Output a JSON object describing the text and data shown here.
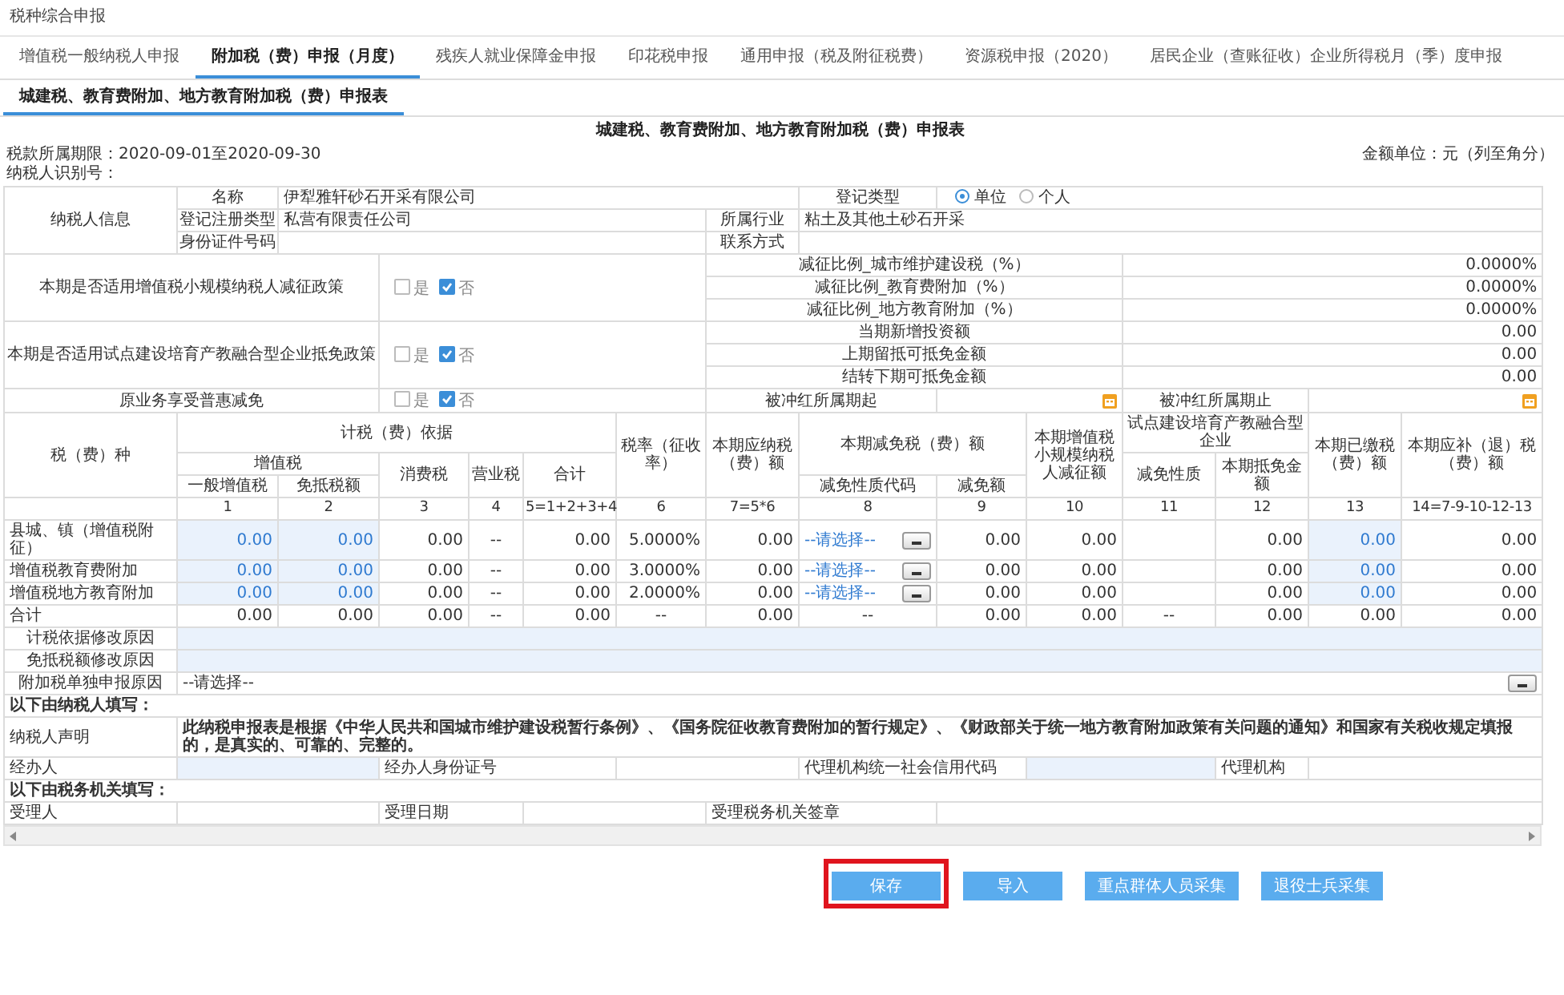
{
  "window": {
    "title": "税种综合申报"
  },
  "tabs": [
    {
      "label": "增值税一般纳税人申报",
      "selected": false
    },
    {
      "label": "附加税（费）申报（月度）",
      "selected": true
    },
    {
      "label": "残疾人就业保障金申报",
      "selected": false
    },
    {
      "label": "印花税申报",
      "selected": false
    },
    {
      "label": "通用申报（税及附征税费）",
      "selected": false
    },
    {
      "label": "资源税申报（2020）",
      "selected": false
    },
    {
      "label": "居民企业（查账征收）企业所得税月（季）度申报",
      "selected": false
    }
  ],
  "sub_tabs": [
    {
      "label": "城建税、教育费附加、地方教育附加税（费）申报表",
      "selected": true
    }
  ],
  "form": {
    "title": "城建税、教育费附加、地方教育附加税（费）申报表",
    "period": "税款所属期限：2020-09-01至2020-09-30",
    "unit": "金额单位：元（列至角分）",
    "taxpayer_id_label": "纳税人识别号："
  },
  "taxpayer_info": {
    "section_label": "纳税人信息",
    "name_label": "名称",
    "name": "伊犁雅轩砂石开采有限公司",
    "reg_kind_label": "登记类型",
    "reg_kinds": [
      {
        "label": "单位",
        "selected": true
      },
      {
        "label": "个人",
        "selected": false
      }
    ],
    "reg_type_label": "登记注册类型",
    "reg_type": "私营有限责任公司",
    "industry_label": "所属行业",
    "industry": "粘土及其他土砂石开采",
    "id_label": "身份证件号码",
    "contact_label": "联系方式"
  },
  "policies": [
    {
      "label": "本期是否适用增值税小规模纳税人减征政策",
      "options": [
        {
          "label": "是",
          "checked": false
        },
        {
          "label": "否",
          "checked": true
        }
      ],
      "items": [
        {
          "label": "减征比例_城市维护建设税（%）",
          "value": "0.0000%"
        },
        {
          "label": "减征比例_教育费附加（%）",
          "value": "0.0000%"
        },
        {
          "label": "减征比例_地方教育附加（%）",
          "value": "0.0000%"
        }
      ]
    },
    {
      "label": "本期是否适用试点建设培育产教融合型企业抵免政策",
      "options": [
        {
          "label": "是",
          "checked": false
        },
        {
          "label": "否",
          "checked": true
        }
      ],
      "items": [
        {
          "label": "当期新增投资额",
          "value": "0.00"
        },
        {
          "label": "上期留抵可抵免金额",
          "value": "0.00"
        },
        {
          "label": "结转下期可抵免金额",
          "value": "0.00"
        }
      ]
    }
  ],
  "relief": {
    "label": "原业务享受普惠减免",
    "options": [
      {
        "label": "是",
        "checked": false
      },
      {
        "label": "否",
        "checked": true
      }
    ],
    "start_label": "被冲红所属期起",
    "end_label": "被冲红所属期止"
  },
  "header": {
    "tax_kind": "税（费）种",
    "basis": "计税（费）依据",
    "vat": "增值税",
    "general_vat": "一般增值税",
    "exempt_offset": "免抵税额",
    "consumption": "消费税",
    "business": "营业税",
    "total": "合计",
    "rate": "税率（征收率）",
    "payable": "本期应纳税（费）额",
    "relief": "本期减免税（费）额",
    "relief_code": "减免性质代码",
    "relief_amount": "减免额",
    "small_scale": "本期增值税小规模纳税人减征额",
    "pilot": "试点建设培育产教融合型企业",
    "pilot_nature": "减免性质",
    "pilot_credit": "本期抵免金额",
    "paid": "本期已缴税（费）额",
    "due": "本期应补（退）税（费）额"
  },
  "column_numbers": [
    "1",
    "2",
    "3",
    "4",
    "5=1+2+3+4",
    "6",
    "7=5*6",
    "8",
    "9",
    "10",
    "11",
    "12",
    "13",
    "14=7-9-10-12-13"
  ],
  "rows": [
    {
      "name": "县城、镇（增值税附征）",
      "cells": [
        {
          "kind": "input",
          "value": "0.00"
        },
        {
          "kind": "input",
          "value": "0.00"
        },
        {
          "kind": "text",
          "value": "0.00"
        },
        {
          "kind": "na",
          "value": "--"
        },
        {
          "kind": "text",
          "value": "0.00"
        },
        {
          "kind": "text",
          "value": "5.0000%"
        },
        {
          "kind": "text",
          "value": "0.00"
        },
        {
          "kind": "select",
          "value": "--请选择--"
        },
        {
          "kind": "text",
          "value": "0.00"
        },
        {
          "kind": "text",
          "value": "0.00"
        },
        {
          "kind": "empty"
        },
        {
          "kind": "text",
          "value": "0.00"
        },
        {
          "kind": "input",
          "value": "0.00"
        },
        {
          "kind": "text",
          "value": "0.00"
        }
      ]
    },
    {
      "name": "增值税教育费附加",
      "cells": [
        {
          "kind": "input",
          "value": "0.00"
        },
        {
          "kind": "input",
          "value": "0.00"
        },
        {
          "kind": "text",
          "value": "0.00"
        },
        {
          "kind": "na",
          "value": "--"
        },
        {
          "kind": "text",
          "value": "0.00"
        },
        {
          "kind": "text",
          "value": "3.0000%"
        },
        {
          "kind": "text",
          "value": "0.00"
        },
        {
          "kind": "select",
          "value": "--请选择--"
        },
        {
          "kind": "text",
          "value": "0.00"
        },
        {
          "kind": "text",
          "value": "0.00"
        },
        {
          "kind": "empty"
        },
        {
          "kind": "text",
          "value": "0.00"
        },
        {
          "kind": "input",
          "value": "0.00"
        },
        {
          "kind": "text",
          "value": "0.00"
        }
      ]
    },
    {
      "name": "增值税地方教育附加",
      "cells": [
        {
          "kind": "input",
          "value": "0.00"
        },
        {
          "kind": "input",
          "value": "0.00"
        },
        {
          "kind": "text",
          "value": "0.00"
        },
        {
          "kind": "na",
          "value": "--"
        },
        {
          "kind": "text",
          "value": "0.00"
        },
        {
          "kind": "text",
          "value": "2.0000%"
        },
        {
          "kind": "text",
          "value": "0.00"
        },
        {
          "kind": "select",
          "value": "--请选择--"
        },
        {
          "kind": "text",
          "value": "0.00"
        },
        {
          "kind": "text",
          "value": "0.00"
        },
        {
          "kind": "empty"
        },
        {
          "kind": "text",
          "value": "0.00"
        },
        {
          "kind": "input",
          "value": "0.00"
        },
        {
          "kind": "text",
          "value": "0.00"
        }
      ]
    },
    {
      "name": "合计",
      "cells": [
        {
          "kind": "text",
          "value": "0.00"
        },
        {
          "kind": "text",
          "value": "0.00"
        },
        {
          "kind": "text",
          "value": "0.00"
        },
        {
          "kind": "na",
          "value": "--"
        },
        {
          "kind": "text",
          "value": "0.00"
        },
        {
          "kind": "na",
          "value": "--"
        },
        {
          "kind": "text",
          "value": "0.00"
        },
        {
          "kind": "na",
          "value": "--"
        },
        {
          "kind": "text",
          "value": "0.00"
        },
        {
          "kind": "text",
          "value": "0.00"
        },
        {
          "kind": "na",
          "value": "--"
        },
        {
          "kind": "text",
          "value": "0.00"
        },
        {
          "kind": "text",
          "value": "0.00"
        },
        {
          "kind": "text",
          "value": "0.00"
        }
      ]
    }
  ],
  "reasons": [
    {
      "label": "计税依据修改原因",
      "kind": "input"
    },
    {
      "label": "免抵税额修改原因",
      "kind": "input"
    },
    {
      "label": "附加税单独申报原因",
      "kind": "select",
      "value": "--请选择--"
    }
  ],
  "taxpayer_section": "以下由纳税人填写：",
  "declaration": {
    "label": "纳税人声明",
    "text": "此纳税申报表是根据《中华人民共和国城市维护建设税暂行条例》、《国务院征收教育费附加的暂行规定》、《财政部关于统一地方教育附加政策有关问题的通知》和国家有关税收规定填报的，是真实的、可靠的、完整的。"
  },
  "agent_fields": [
    {
      "label": "经办人",
      "editable": true
    },
    {
      "label": "经办人身份证号",
      "editable": false
    },
    {
      "label": "代理机构统一社会信用代码",
      "editable": true
    },
    {
      "label": "代理机构",
      "editable": false
    }
  ],
  "office_section": "以下由税务机关填写：",
  "office_fields": [
    {
      "label": "受理人"
    },
    {
      "label": "受理日期"
    },
    {
      "label": "受理税务机关签章"
    }
  ],
  "buttons": [
    {
      "label": "保存",
      "highlighted": true
    },
    {
      "label": "导入",
      "highlighted": false
    },
    {
      "label": "重点群体人员采集",
      "highlighted": false
    },
    {
      "label": "退役士兵采集",
      "highlighted": false
    }
  ]
}
